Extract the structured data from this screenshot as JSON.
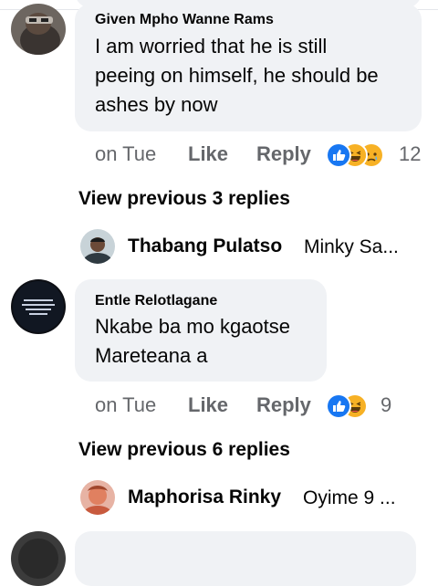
{
  "comments": [
    {
      "author": "Given Mpho Wanne Rams",
      "text_lines": [
        "I am worried that he is still",
        "peeing on himself, he should be",
        "ashes by now"
      ],
      "time": "on Tue",
      "like_label": "Like",
      "reply_label": "Reply",
      "reactions": [
        "like",
        "haha",
        "sad"
      ],
      "reaction_count": "12",
      "view_previous": "View previous 3 replies",
      "latest_reply": {
        "author": "Thabang Pulatso",
        "snippet": "Minky Sa..."
      }
    },
    {
      "author": "Entle Relotlagane",
      "text_lines": [
        "Nkabe ba mo kgaotse",
        "Mareteana a"
      ],
      "time": "on Tue",
      "like_label": "Like",
      "reply_label": "Reply",
      "reactions": [
        "like",
        "haha"
      ],
      "reaction_count": "9",
      "view_previous": "View previous 6 replies",
      "latest_reply": {
        "author": "Maphorisa Rinky",
        "snippet": "Oyime 9 ..."
      }
    }
  ],
  "colors": {
    "bubble": "#f0f2f5",
    "meta_text": "#65676b",
    "like_blue": "#1877f2",
    "haha_yellow": "#f7b125"
  }
}
